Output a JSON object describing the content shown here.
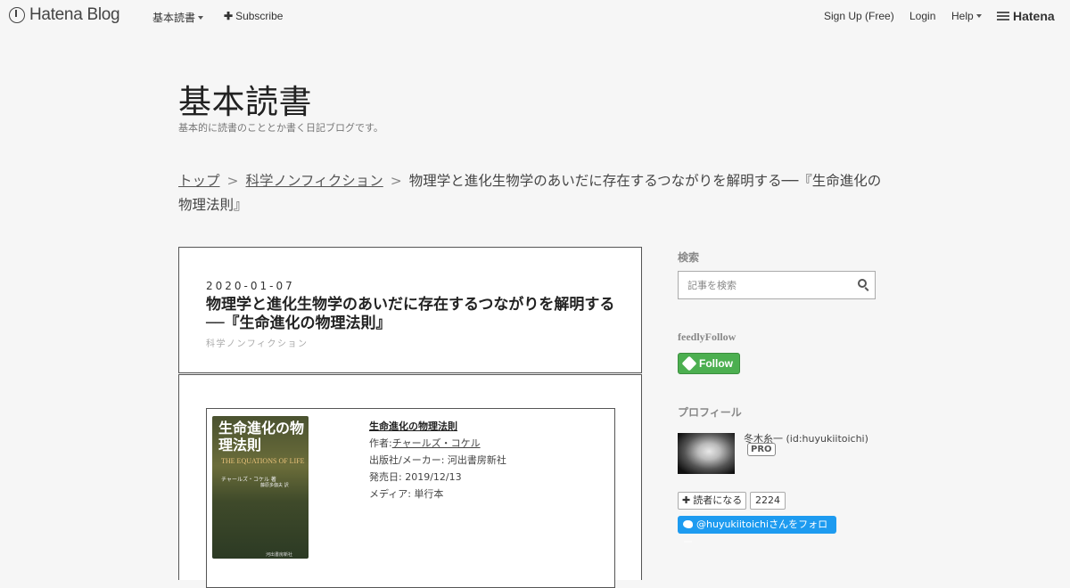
{
  "global_header": {
    "logo": "Hatena Blog",
    "menu": "基本読書",
    "subscribe": "Subscribe",
    "signup": "Sign Up (Free)",
    "login": "Login",
    "help": "Help",
    "hatena": "Hatena"
  },
  "blog": {
    "title": "基本読書",
    "description": "基本的に読書のこととか書く日記ブログです。"
  },
  "breadcrumb": {
    "top": "トップ",
    "separator": ">",
    "category": "科学ノンフィクション",
    "current": "物理学と進化生物学のあいだに存在するつながりを解明する──『生命進化の物理法則』"
  },
  "entry": {
    "date": "2020-01-07",
    "title": "物理学と進化生物学のあいだに存在するつながりを解明する──『生命進化の物理法則』",
    "category": "科学ノンフィクション"
  },
  "book": {
    "cover_title": "生命進化の物理法則",
    "cover_subtitle": "THE EQUATIONS OF LIFE",
    "cover_author": "チャールズ・コケル 著",
    "cover_translator": "藤原多伽夫 訳",
    "cover_publisher": "河出書房新社",
    "title": "生命進化の物理法則",
    "author_label": "作者:",
    "author": "チャールズ・コケル",
    "publisher": "出版社/メーカー: 河出書房新社",
    "release": "発売日: 2019/12/13",
    "media": "メディア: 単行本"
  },
  "sidebar": {
    "search_heading": "検索",
    "search_placeholder": "記事を検索",
    "feedly_heading": "feedlyFollow",
    "feedly_button": "Follow",
    "profile_heading": "プロフィール",
    "profile_name": "冬木糸一 (id:huyukiitoichi)",
    "pro_badge": "PRO",
    "reader_button": "読者になる",
    "reader_count": "2224",
    "twitter_button": "@huyukiitoichiさんをフォロー"
  },
  "colors": {
    "background": "#f6f6f6",
    "feedly_green": "#4caf50",
    "twitter_blue": "#1d9bf0"
  }
}
